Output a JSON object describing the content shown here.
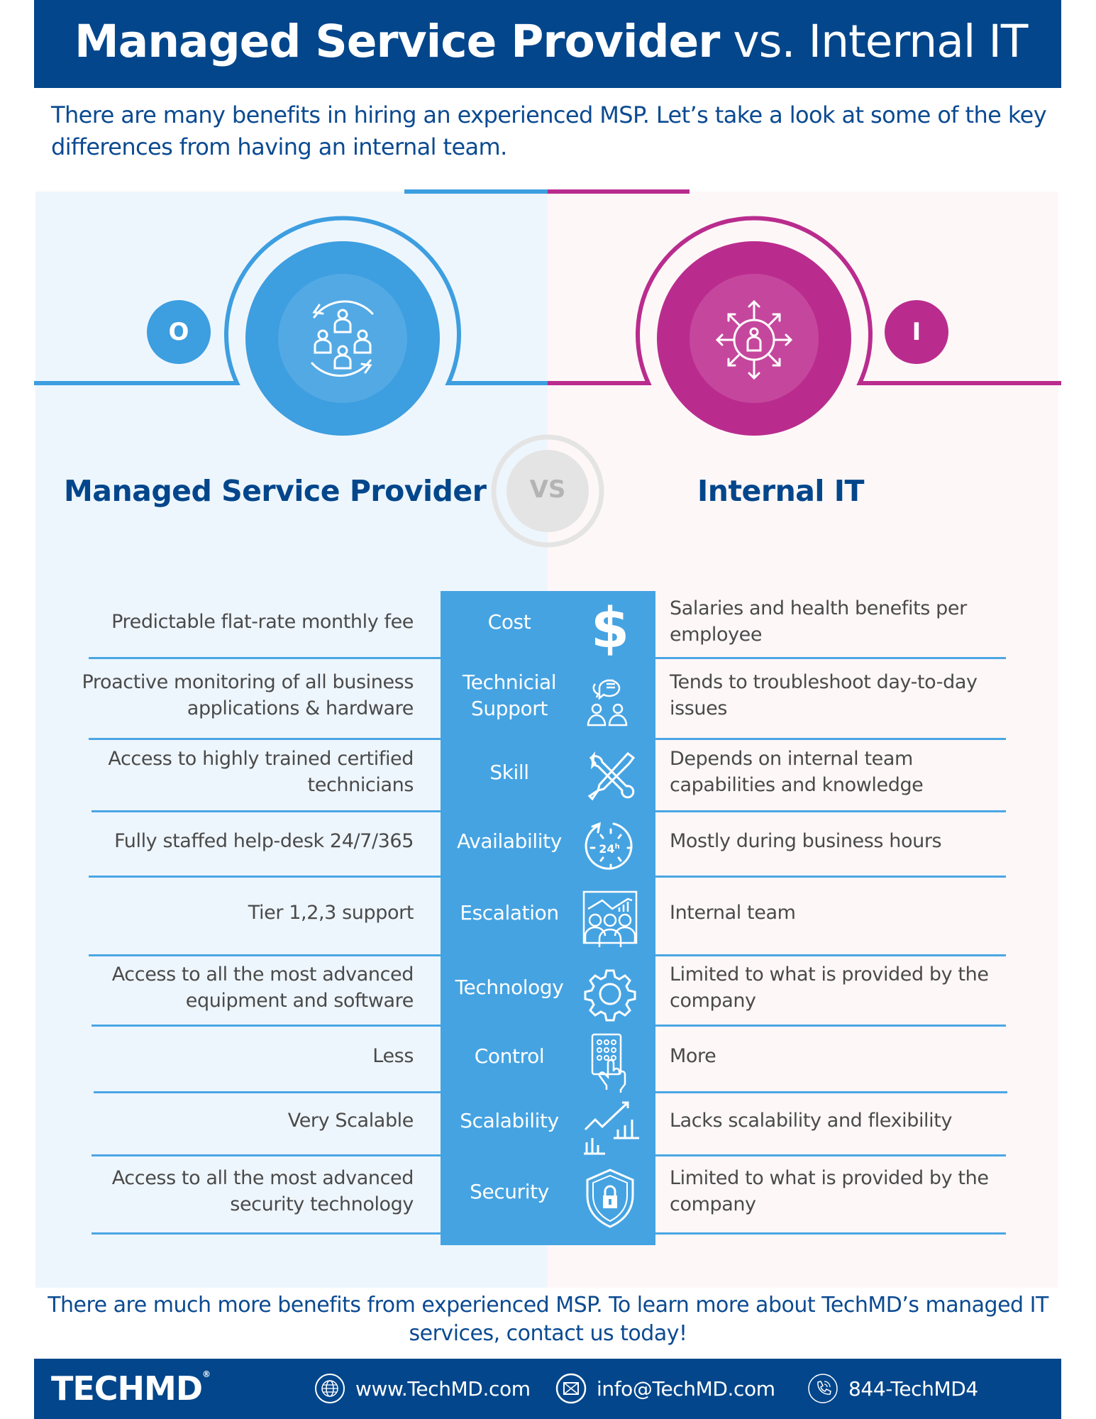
{
  "header": {
    "title_bold": "Managed Service Provider",
    "title_light": " vs. Internal IT"
  },
  "intro": "There are many benefits in hiring an experienced MSP. Let’s take a look at some of the key differences from having an internal team.",
  "colors": {
    "navy": "#03468b",
    "msp_blue": "#3d9ee0",
    "internal_magenta": "#b92c8e",
    "center_column": "#45a3e2"
  },
  "sides": {
    "left": {
      "badge": "O",
      "heading": "Managed Service Provider",
      "icon": "team-rotation-icon"
    },
    "right": {
      "badge": "I",
      "heading": "Internal IT",
      "icon": "person-network-arrows-icon"
    }
  },
  "vs_label": "VS",
  "comparison": [
    {
      "category": "Cost",
      "icon": "dollar-icon",
      "msp": "Predictable flat-rate monthly fee",
      "internal": "Salaries and health benefits per employee"
    },
    {
      "category": "Technicial Support",
      "icon": "support-chat-people-icon",
      "msp": "Proactive monitoring of all business applications & hardware",
      "internal": "Tends to troubleshoot day-to-day issues"
    },
    {
      "category": "Skill",
      "icon": "wrench-screwdriver-icon",
      "msp": "Access to highly trained certified technicians",
      "internal": "Depends on internal team capabilities and knowledge"
    },
    {
      "category": "Availability",
      "icon": "clock-24h-icon",
      "msp": "Fully staffed help-desk 24/7/365",
      "internal": "Mostly during business hours"
    },
    {
      "category": "Escalation",
      "icon": "team-chart-icon",
      "msp": "Tier 1,2,3 support",
      "internal": "Internal team"
    },
    {
      "category": "Technology",
      "icon": "gear-icon",
      "msp": "Access to all the most advanced equipment and software",
      "internal": "Limited to what is provided by the company"
    },
    {
      "category": "Control",
      "icon": "keypad-hand-icon",
      "msp": "Less",
      "internal": "More"
    },
    {
      "category": "Scalability",
      "icon": "growth-chart-icon",
      "msp": "Very Scalable",
      "internal": "Lacks scalability and flexibility"
    },
    {
      "category": "Security",
      "icon": "shield-lock-icon",
      "msp": "Access to all the most advanced security technology",
      "internal": "Limited to what is provided by the company"
    }
  ],
  "closing": "There are much more benefits from experienced MSP. To learn more about TechMD’s managed IT services, contact us today!",
  "footer": {
    "logo": "TECHMD",
    "website": "www.TechMD.com",
    "email": "info@TechMD.com",
    "phone": "844-TechMD4"
  }
}
